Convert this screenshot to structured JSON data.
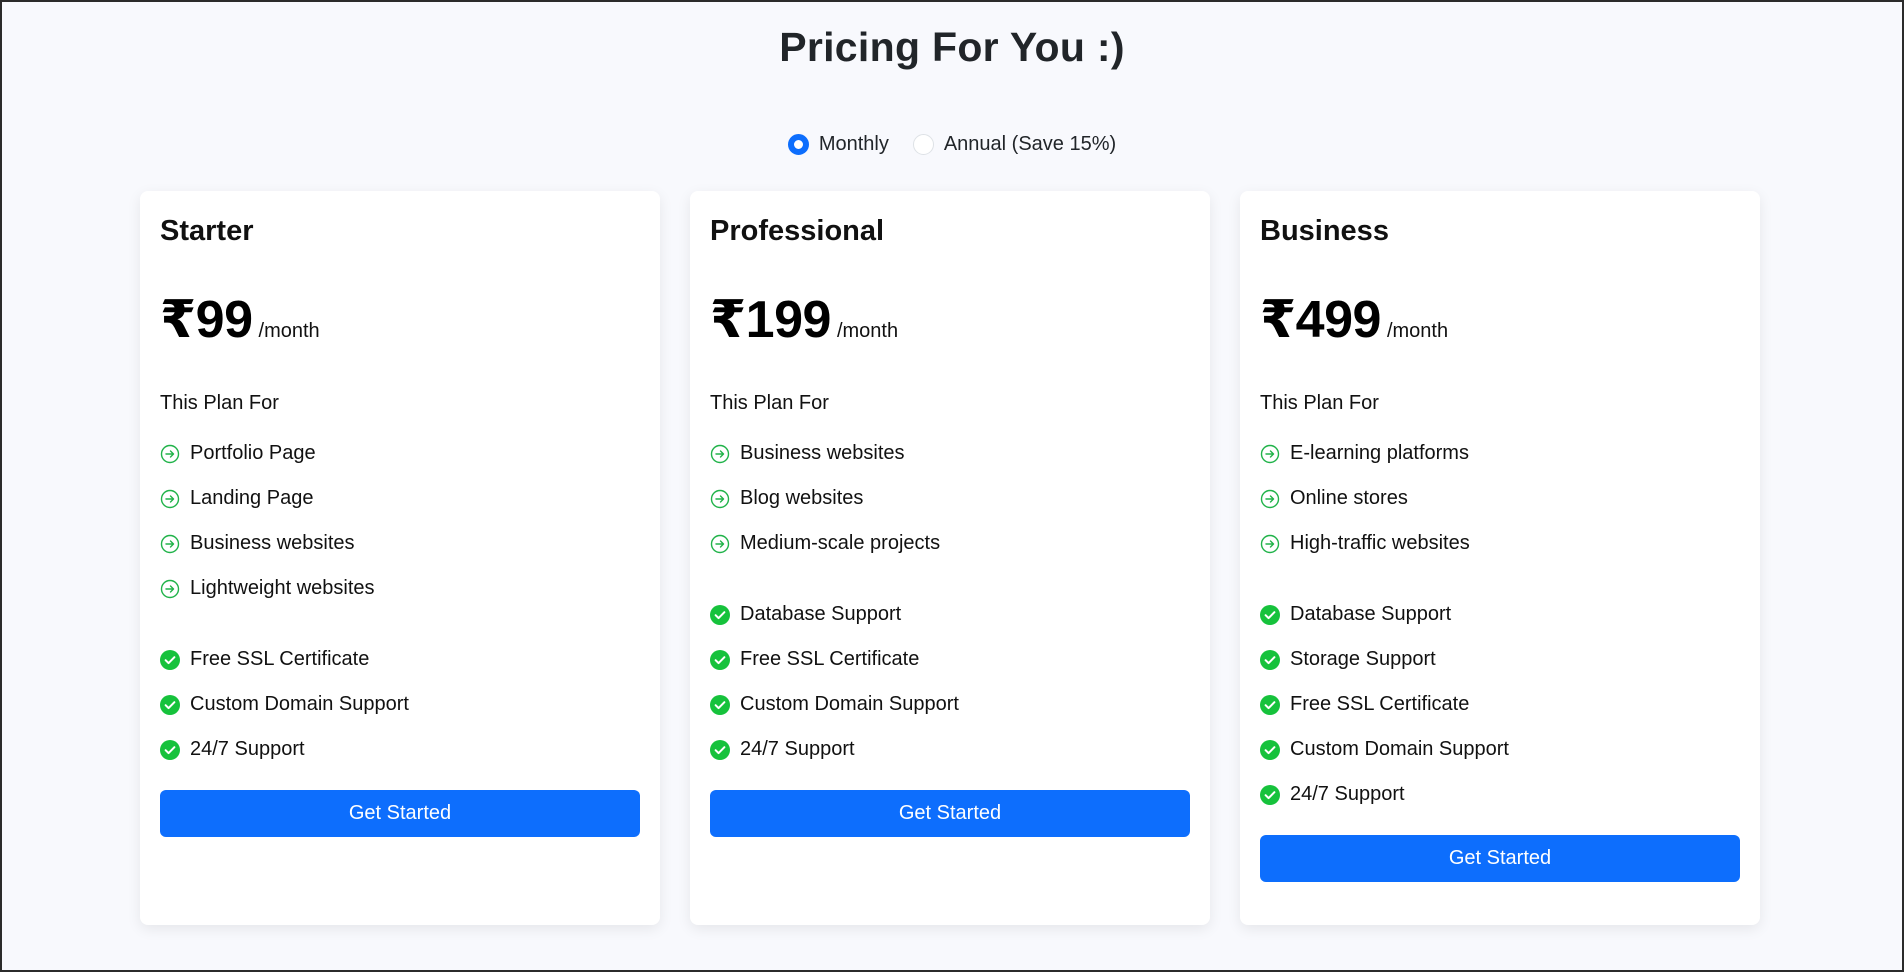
{
  "page": {
    "title": "Pricing For You :)"
  },
  "billing_toggle": {
    "options": [
      {
        "label": "Monthly",
        "selected": true
      },
      {
        "label": "Annual (Save 15%)",
        "selected": false
      }
    ]
  },
  "colors": {
    "accent": "#0d6efd",
    "check": "#16c23c",
    "arrow": "#21b34a"
  },
  "plans": [
    {
      "name": "Starter",
      "price": "₹99",
      "period": "/month",
      "plan_for_label": "This Plan For",
      "uses": [
        "Portfolio Page",
        "Landing Page",
        "Business websites",
        "Lightweight websites"
      ],
      "features": [
        "Free SSL Certificate",
        "Custom Domain Support",
        "24/7 Support"
      ],
      "cta": "Get Started"
    },
    {
      "name": "Professional",
      "price": "₹199",
      "period": "/month",
      "plan_for_label": "This Plan For",
      "uses": [
        "Business websites",
        "Blog websites",
        "Medium-scale projects"
      ],
      "features": [
        "Database Support",
        "Free SSL Certificate",
        "Custom Domain Support",
        "24/7 Support"
      ],
      "cta": "Get Started"
    },
    {
      "name": "Business",
      "price": "₹499",
      "period": "/month",
      "plan_for_label": "This Plan For",
      "uses": [
        "E-learning platforms",
        "Online stores",
        "High-traffic websites"
      ],
      "features": [
        "Database Support",
        "Storage Support",
        "Free SSL Certificate",
        "Custom Domain Support",
        "24/7 Support"
      ],
      "cta": "Get Started"
    }
  ]
}
